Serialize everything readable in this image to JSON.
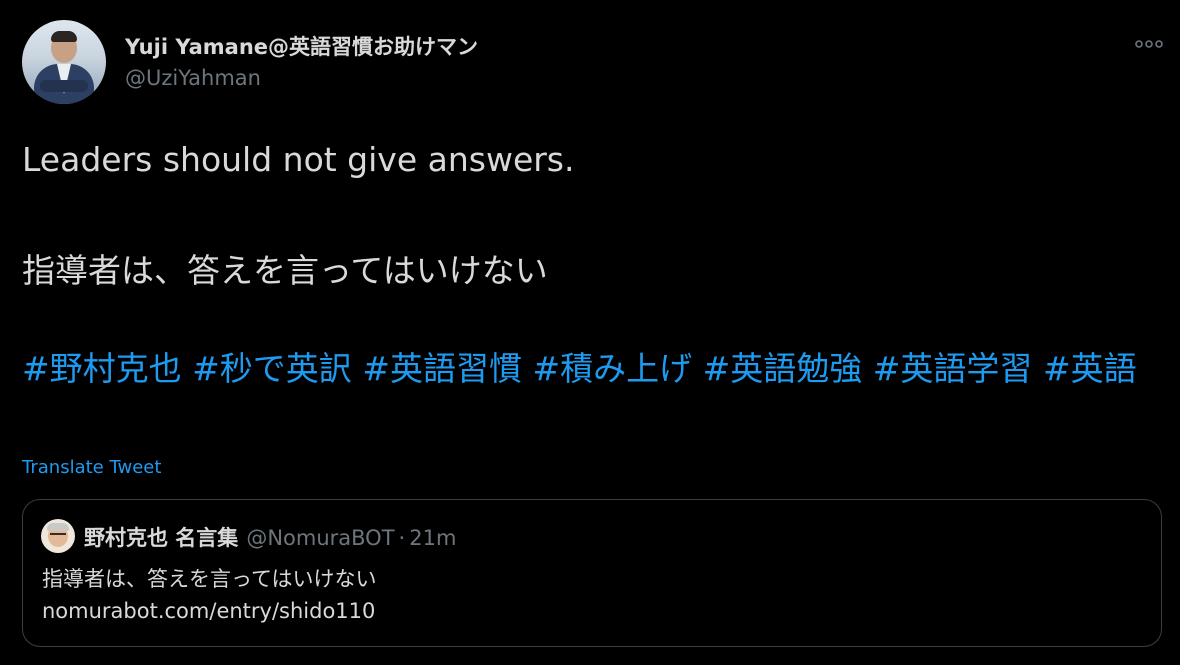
{
  "author": {
    "name": "Yuji Yamane@英語習慣お助けマン",
    "handle": "@UziYahman",
    "avatar_icon": "profile-photo"
  },
  "tweet": {
    "line1": "Leaders should not give answers.",
    "line2": "指導者は、答えを言ってはいけない",
    "hashtags": [
      "#野村克也",
      "#秒で英訳",
      "#英語習慣",
      "#積み上げ",
      "#英語勉強",
      "#英語学習",
      "#英語"
    ],
    "translate_label": "Translate Tweet"
  },
  "quote": {
    "name": "野村克也 名言集",
    "handle": "@NomuraBOT",
    "separator": "·",
    "time": "21m",
    "text_line1": "指導者は、答えを言ってはいけない",
    "text_line2": "nomurabot.com/entry/shido110"
  },
  "icons": {
    "more": "more-horizontal-icon"
  },
  "colors": {
    "background": "#000000",
    "text": "#d9d9d9",
    "muted": "#6e767d",
    "accent": "#1d9bf0",
    "border": "#3a3d41"
  }
}
